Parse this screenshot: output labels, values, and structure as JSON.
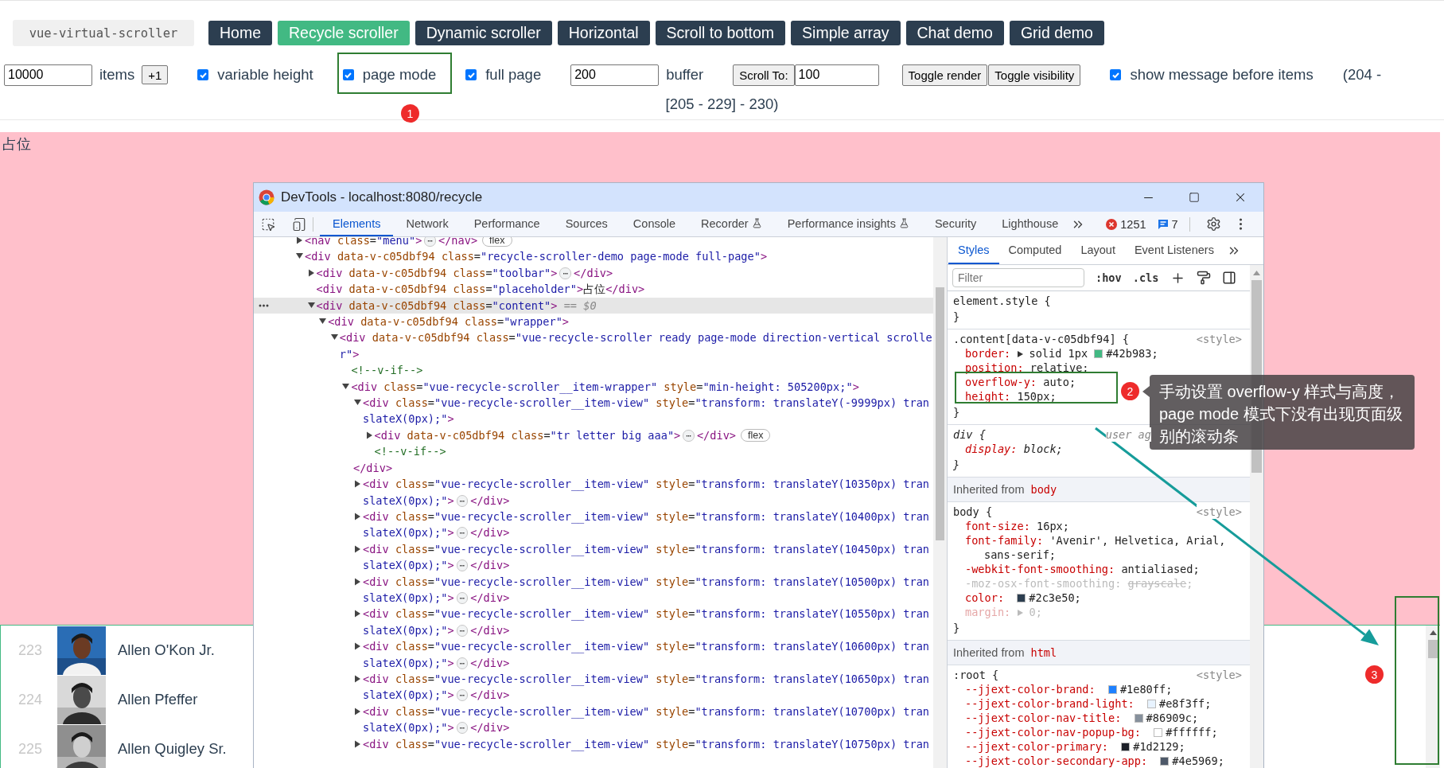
{
  "header": {
    "logo": "vue-virtual-scroller",
    "nav": [
      {
        "label": "Home",
        "selected": false
      },
      {
        "label": "Recycle scroller",
        "selected": true
      },
      {
        "label": "Dynamic scroller",
        "selected": false
      },
      {
        "label": "Horizontal",
        "selected": false
      },
      {
        "label": "Scroll to bottom",
        "selected": false
      },
      {
        "label": "Simple array",
        "selected": false
      },
      {
        "label": "Chat demo",
        "selected": false
      },
      {
        "label": "Grid demo",
        "selected": false
      }
    ]
  },
  "toolbar": {
    "count": "10000",
    "items_label": "items",
    "plus_button": "+1",
    "variable_height": {
      "label": "variable height",
      "checked": true
    },
    "page_mode": {
      "label": "page mode",
      "checked": true
    },
    "full_page": {
      "label": "full page",
      "checked": true
    },
    "buffer": {
      "value": "200",
      "label": "buffer"
    },
    "scroll_to": {
      "button": "Scroll To:",
      "value": "100"
    },
    "toggle_render": "Toggle render",
    "toggle_visibility": "Toggle visibility",
    "show_message": {
      "label": "show message before items",
      "checked": true
    },
    "range_start": "(204 -",
    "range_rest": "[205 - 229] - 230)"
  },
  "placeholder": "占位",
  "list": [
    {
      "index": "223",
      "name": "Allen O'Kon Jr."
    },
    {
      "index": "224",
      "name": "Allen Pfeffer"
    },
    {
      "index": "225",
      "name": "Allen Quigley Sr."
    }
  ],
  "devtools": {
    "title": "DevTools - localhost:8080/recycle",
    "tabs": [
      {
        "label": "Elements",
        "selected": true,
        "experimental": false
      },
      {
        "label": "Network",
        "selected": false,
        "experimental": false
      },
      {
        "label": "Performance",
        "selected": false,
        "experimental": false
      },
      {
        "label": "Sources",
        "selected": false,
        "experimental": false
      },
      {
        "label": "Console",
        "selected": false,
        "experimental": false
      },
      {
        "label": "Recorder",
        "selected": false,
        "experimental": true
      },
      {
        "label": "Performance insights",
        "selected": false,
        "experimental": true
      },
      {
        "label": "Security",
        "selected": false,
        "experimental": false
      },
      {
        "label": "Lighthouse",
        "selected": false,
        "experimental": false
      }
    ],
    "errors": "1251",
    "messages": "7",
    "tree": [
      {
        "open": "<nav class=\"menu\">",
        "expanded": false,
        "badge": "⋯",
        "close": "</nav>",
        "tag": "flex",
        "selected": false
      },
      {
        "open": "<div data-v-c05dbf94 class=\"recycle-scroller-demo page-mode full-page\">",
        "expanded": true,
        "selected": false,
        "children": [
          {
            "open": "<div data-v-c05dbf94 class=\"toolbar\">",
            "expanded": false,
            "badge": "⋯",
            "close": "</div>",
            "selected": false
          },
          {
            "open": "<div data-v-c05dbf94 class=\"placeholder\">占位</div>",
            "selected": false
          },
          {
            "open": "<div data-v-c05dbf94 class=\"content\">",
            "expanded": true,
            "selected": true,
            "suffix": "== $0",
            "children": [
              {
                "open": "<div data-v-c05dbf94 class=\"wrapper\">",
                "expanded": true,
                "selected": false,
                "children": [
                  {
                    "open": "<div data-v-c05dbf94 class=\"vue-recycle-scroller ready page-mode direction-vertical scroller\">",
                    "expanded": true,
                    "selected": false,
                    "children": [
                      {
                        "open": "<!--v-if-->",
                        "selected": false
                      },
                      {
                        "open": "<div class=\"vue-recycle-scroller__item-wrapper\" style=\"min-height: 505200px;\">",
                        "expanded": true,
                        "selected": false,
                        "children": [
                          {
                            "open": "<div class=\"vue-recycle-scroller__item-view\" style=\"transform: translateY(-9999px) translateX(0px);\">",
                            "expanded": true,
                            "close": "</div>",
                            "selected": false,
                            "children": [
                              {
                                "open": "<div data-v-c05dbf94 class=\"tr letter big aaa\">",
                                "expanded": false,
                                "badge": "⋯",
                                "close": "</div>",
                                "tag": "flex",
                                "selected": false
                              },
                              {
                                "open": "<!--v-if-->",
                                "selected": false
                              }
                            ]
                          },
                          {
                            "open": "<div class=\"vue-recycle-scroller__item-view\" style=\"transform: translateY(10350px) translateX(0px);\">",
                            "expanded": false,
                            "badge": "⋯",
                            "close": "</div>",
                            "selected": false
                          },
                          {
                            "open": "<div class=\"vue-recycle-scroller__item-view\" style=\"transform: translateY(10400px) translateX(0px);\">",
                            "expanded": false,
                            "badge": "⋯",
                            "close": "</div>",
                            "selected": false
                          },
                          {
                            "open": "<div class=\"vue-recycle-scroller__item-view\" style=\"transform: translateY(10450px) translateX(0px);\">",
                            "expanded": false,
                            "badge": "⋯",
                            "close": "</div>",
                            "selected": false
                          },
                          {
                            "open": "<div class=\"vue-recycle-scroller__item-view\" style=\"transform: translateY(10500px) translateX(0px);\">",
                            "expanded": false,
                            "badge": "⋯",
                            "close": "</div>",
                            "selected": false
                          },
                          {
                            "open": "<div class=\"vue-recycle-scroller__item-view\" style=\"transform: translateY(10550px) translateX(0px);\">",
                            "expanded": false,
                            "badge": "⋯",
                            "close": "</div>",
                            "selected": false
                          },
                          {
                            "open": "<div class=\"vue-recycle-scroller__item-view\" style=\"transform: translateY(10600px) translateX(0px);\">",
                            "expanded": false,
                            "badge": "⋯",
                            "close": "</div>",
                            "selected": false
                          },
                          {
                            "open": "<div class=\"vue-recycle-scroller__item-view\" style=\"transform: translateY(10650px) translateX(0px);\">",
                            "expanded": false,
                            "badge": "⋯",
                            "close": "</div>",
                            "selected": false
                          },
                          {
                            "open": "<div class=\"vue-recycle-scroller__item-view\" style=\"transform: translateY(10700px) translateX(0px);\">",
                            "expanded": false,
                            "badge": "⋯",
                            "close": "</div>",
                            "selected": false
                          },
                          {
                            "open": "<div class=\"vue-recycle-scroller__item-view\" style=\"transform: translateY(10750px) tran",
                            "expanded": false,
                            "selected": false
                          }
                        ]
                      }
                    ]
                  }
                ]
              }
            ]
          }
        ]
      }
    ],
    "style_tabs": [
      {
        "label": "Styles",
        "selected": true
      },
      {
        "label": "Computed",
        "selected": false
      },
      {
        "label": "Layout",
        "selected": false
      },
      {
        "label": "Event Listeners",
        "selected": false
      }
    ],
    "filter_placeholder": "Filter",
    "hov": ":hov",
    "cls": ".cls",
    "sections": [
      {
        "kind": "rule",
        "selector": "element.style {",
        "close": "}"
      },
      {
        "kind": "rule",
        "selector": ".content[data-v-c05dbf94] {",
        "source": "<style>",
        "close": "}",
        "properties": [
          {
            "name": "border:",
            "expandable": true,
            "value": "solid 1px",
            "color": "#42b983",
            "color_value": "#42b983;",
            "overridden": false,
            "inactive": false
          },
          {
            "name": "position:",
            "expandable": false,
            "value": "relative;",
            "overridden": false,
            "inactive": false
          },
          {
            "name": "overflow-y:",
            "expandable": false,
            "value": "auto;",
            "overridden": false,
            "inactive": false
          },
          {
            "name": "height:",
            "expandable": false,
            "value": "150px;",
            "overridden": false,
            "inactive": false
          }
        ]
      },
      {
        "kind": "ua-rule",
        "selector": "div {",
        "source": "user ag",
        "close": "}",
        "properties": [
          {
            "name": "display:",
            "expandable": false,
            "value": "block;",
            "overridden": false,
            "inactive": false
          }
        ]
      },
      {
        "kind": "inherited",
        "label": "Inherited from",
        "element": "body"
      },
      {
        "kind": "rule",
        "selector": "body {",
        "source": "<style>",
        "close": "}",
        "properties": [
          {
            "name": "font-size:",
            "expandable": false,
            "value": "16px;",
            "overridden": false,
            "inactive": false
          },
          {
            "name": "font-family:",
            "expandable": false,
            "value": "'Avenir', Helvetica, Arial, sans-serif;",
            "overridden": false,
            "inactive": false
          },
          {
            "name": "-webkit-font-smoothing:",
            "expandable": false,
            "value": "antialiased;",
            "overridden": false,
            "inactive": false
          },
          {
            "name": "-moz-osx-font-smoothing:",
            "expandable": false,
            "value": "grayscale",
            "after": ";",
            "overridden": true,
            "inactive": false
          },
          {
            "name": "color:",
            "expandable": false,
            "color": "#2c3e50",
            "color_value": "#2c3e50;",
            "overridden": false,
            "inactive": false
          },
          {
            "name": "margin:",
            "expandable": true,
            "value": "0;",
            "overridden": false,
            "inactive": true
          }
        ]
      },
      {
        "kind": "inherited",
        "label": "Inherited from",
        "element": "html"
      },
      {
        "kind": "rule",
        "selector": ":root {",
        "source": "<style>",
        "properties": [
          {
            "name": "--jjext-color-brand:",
            "expandable": false,
            "color": "#1e80ff",
            "color_value": "#1e80ff;",
            "overridden": false,
            "inactive": false
          },
          {
            "name": "--jjext-color-brand-light:",
            "expandable": false,
            "color": "#e8f3ff",
            "color_value": "#e8f3ff;",
            "overridden": false,
            "inactive": false
          },
          {
            "name": "--jjext-color-nav-title:",
            "expandable": false,
            "color": "#86909c",
            "color_value": "#86909c;",
            "overridden": false,
            "inactive": false
          },
          {
            "name": "--jjext-color-nav-popup-bg:",
            "expandable": false,
            "color": "#ffffff",
            "color_value": "#ffffff;",
            "overridden": false,
            "inactive": false
          },
          {
            "name": "--jjext-color-primary:",
            "expandable": false,
            "color": "#1d2129",
            "color_value": "#1d2129;",
            "overridden": false,
            "inactive": false
          },
          {
            "name": "--jjext-color-secondary-app:",
            "expandable": false,
            "color": "#4e5969",
            "color_value": "#4e5969;",
            "overridden": false,
            "inactive": false
          }
        ]
      }
    ]
  },
  "annotations": {
    "badges": [
      "1",
      "2",
      "3"
    ],
    "callout": "手动设置 overflow-y 样式与高度，page mode 模式下没有出现页面级别的滚动条"
  }
}
